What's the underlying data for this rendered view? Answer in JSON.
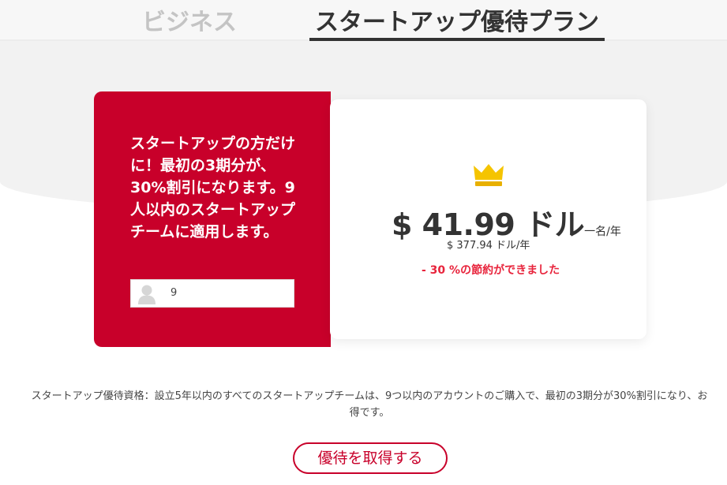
{
  "tabs": {
    "business": "ビジネス",
    "startup": "スタートアップ優待プラン"
  },
  "promo": {
    "text": "スタートアップの方だけに！最初の3期分が、30%割引になります。9人以内のスタートアップチームに適用します。",
    "seats_value": "9",
    "icon": "user-icon"
  },
  "pricing": {
    "icon": "crown-icon",
    "price": "$ 41.99 ドル",
    "per_unit": "一名/年",
    "annual": "$ 377.94 ドル/年",
    "saving": "- 30 %の節約ができました"
  },
  "note": "スタートアップ優待資格：設立5年以内のすべてのスタートアップチームは、9つ以内のアカウントのご購入で、最初の3期分が30%割引になり、お得です。",
  "cta": "優待を取得する",
  "colors": {
    "brand_red": "#c8002a",
    "saving_red": "#e8243c",
    "crown_gold": "#f5c400"
  }
}
